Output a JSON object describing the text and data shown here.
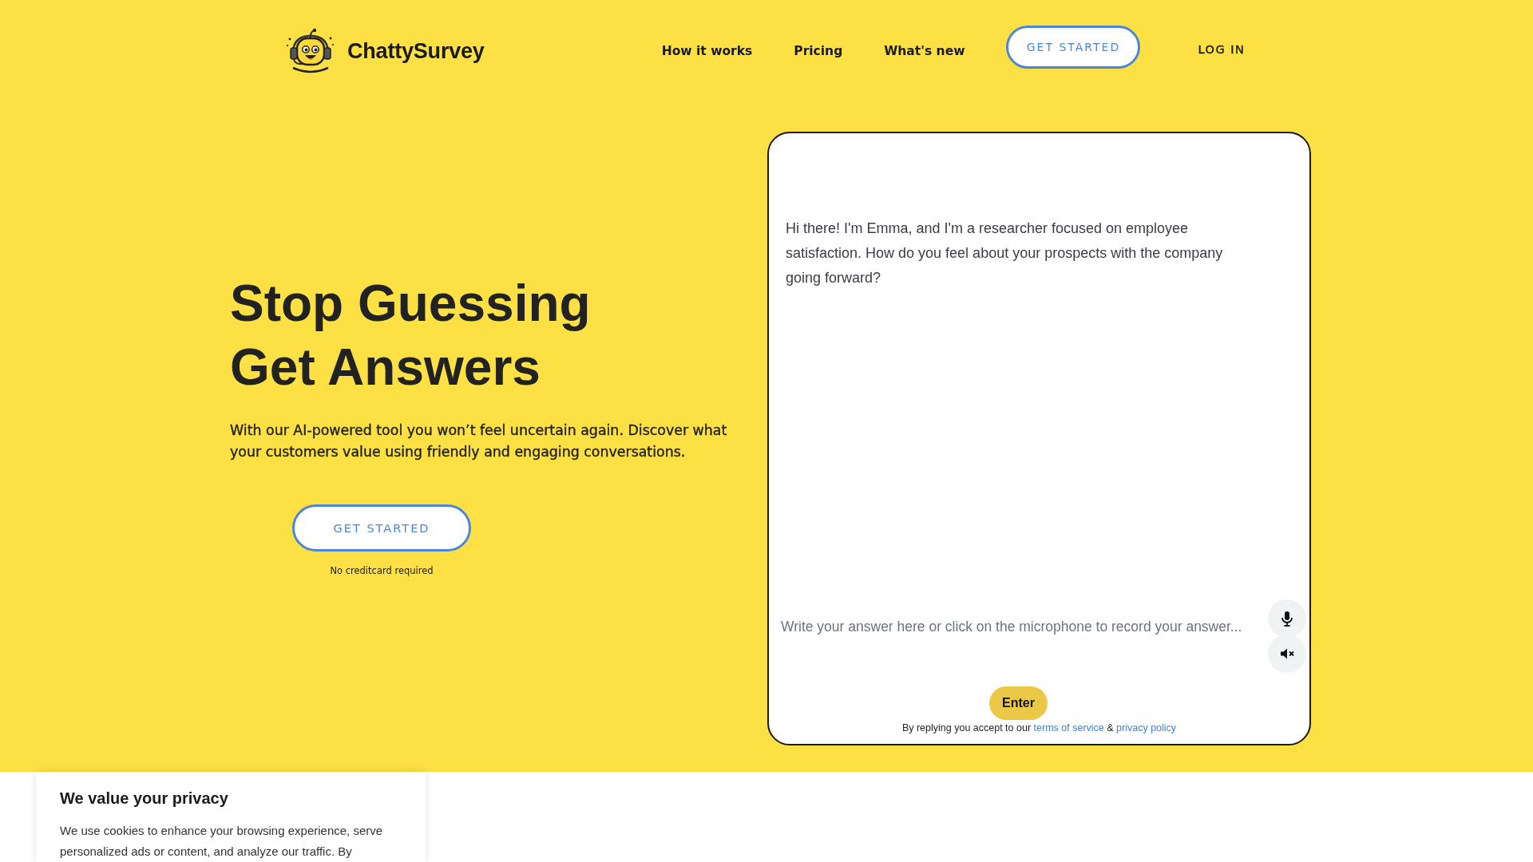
{
  "header": {
    "logo_text": "ChattySurvey",
    "nav_links": [
      "How it works",
      "Pricing",
      "What's new"
    ],
    "cta_button": "GET STARTED",
    "login_link": "LOG IN"
  },
  "hero": {
    "heading_lines": [
      "Stop Guessing",
      "Get Answers"
    ],
    "description": "With our AI-powered tool you won’t feel uncertain again. Discover what your customers value using friendly and engaging conversations.",
    "cta_button": "GET STARTED",
    "cta_note": "No creditcard required"
  },
  "chat": {
    "message": "Hi there! I'm Emma, and I'm a researcher focused on employee satisfaction. How do you feel about your prospects with the company going forward?",
    "answer_field": {
      "placeholder": "Write your answer here or click on the microphone to record your answer..."
    },
    "speaker_muted": true,
    "submit_button": "Enter",
    "consent": {
      "prefix": "By replying you accept to our",
      "terms_link": "terms of service",
      "joiner": "&",
      "privacy_link": "privacy policy"
    }
  },
  "cookie_banner": {
    "title": "We value your privacy",
    "body": "We use cookies to enhance your browsing experience, serve personalized ads or content, and analyze our traffic. By"
  }
}
